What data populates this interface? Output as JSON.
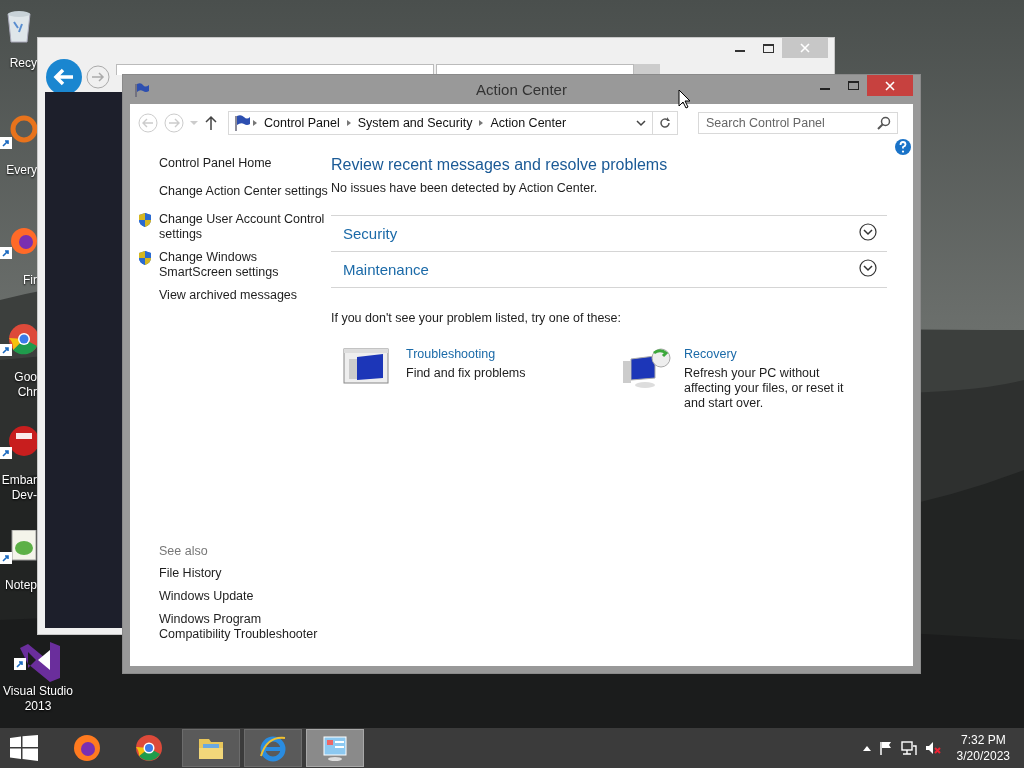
{
  "desktop_icons": [
    {
      "kind": "recycle",
      "lines": [
        "Recy"
      ],
      "shortcut": false
    },
    {
      "kind": "orange",
      "lines": [
        "Every"
      ],
      "shortcut": true
    },
    {
      "kind": "firefox",
      "lines": [
        "Fir"
      ],
      "shortcut": true
    },
    {
      "kind": "chrome",
      "lines": [
        "Goo",
        "Chr"
      ],
      "shortcut": true
    },
    {
      "kind": "red",
      "lines": [
        "Embar",
        "Dev-"
      ],
      "shortcut": true
    },
    {
      "kind": "notepad",
      "lines": [
        "Notep"
      ],
      "shortcut": true
    },
    {
      "kind": "vs",
      "lines": [
        "Visual Studio",
        "2013"
      ],
      "shortcut": true
    }
  ],
  "window": {
    "title": "Action Center",
    "breadcrumb": [
      "Control Panel",
      "System and Security",
      "Action Center"
    ],
    "search": {
      "placeholder": "Search Control Panel"
    },
    "sidebar": {
      "items": [
        {
          "label": "Control Panel Home",
          "shield": false
        },
        {
          "label": "Change Action Center settings",
          "shield": false
        },
        {
          "label": "Change User Account Control settings",
          "shield": true
        },
        {
          "label": "Change Windows SmartScreen settings",
          "shield": true
        },
        {
          "label": "View archived messages",
          "shield": false
        }
      ],
      "see_also": {
        "title": "See also",
        "links": [
          "File History",
          "Windows Update",
          "Windows Program Compatibility Troubleshooter"
        ]
      }
    },
    "heading": "Review recent messages and resolve problems",
    "status": "No issues have been detected by Action Center.",
    "sections": [
      {
        "label": "Security",
        "expanded": false
      },
      {
        "label": "Maintenance",
        "expanded": false
      }
    ],
    "hint": "If you don't see your problem listed, try one of these:",
    "tasks": [
      {
        "kind": "troubleshooting",
        "title": "Troubleshooting",
        "description": "Find and fix problems"
      },
      {
        "kind": "recovery",
        "title": "Recovery",
        "description": "Refresh your PC without affecting your files, or reset it and start over."
      }
    ]
  },
  "taskbar": {
    "apps": [
      {
        "kind": "firefox",
        "open": false,
        "selected": false
      },
      {
        "kind": "chrome",
        "open": false,
        "selected": false
      },
      {
        "kind": "explorer",
        "open": true,
        "selected": false
      },
      {
        "kind": "ie",
        "open": true,
        "selected": false
      },
      {
        "kind": "controlpanel",
        "open": true,
        "selected": true
      }
    ],
    "time": "7:32 PM",
    "date": "3/20/2023"
  }
}
